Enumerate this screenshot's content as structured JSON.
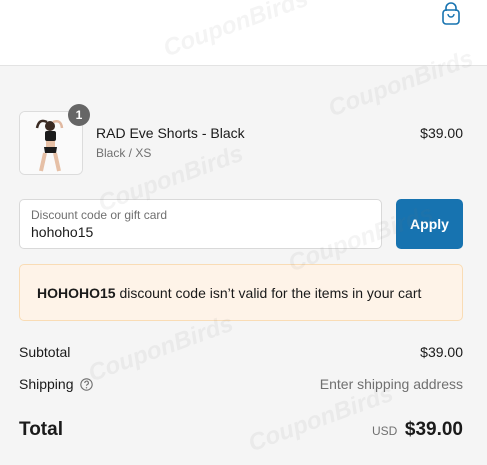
{
  "header": {
    "bag_icon": "shopping-bag-icon"
  },
  "line_item": {
    "quantity": "1",
    "title": "RAD Eve Shorts - Black",
    "variant": "Black / XS",
    "price": "$39.00"
  },
  "discount": {
    "label": "Discount code or gift card",
    "value": "hohoho15",
    "apply_label": "Apply"
  },
  "error": {
    "code": "HOHOHO15",
    "message": " discount code isn’t valid for the items in your cart"
  },
  "totals": {
    "subtotal_label": "Subtotal",
    "subtotal_value": "$39.00",
    "shipping_label": "Shipping",
    "shipping_value": "Enter shipping address",
    "total_label": "Total",
    "total_currency": "USD",
    "total_value": "$39.00"
  },
  "watermark": "CouponBirds",
  "colors": {
    "accent": "#1773b0",
    "error_bg": "#fef3e8",
    "summary_bg": "#f5f5f5"
  }
}
